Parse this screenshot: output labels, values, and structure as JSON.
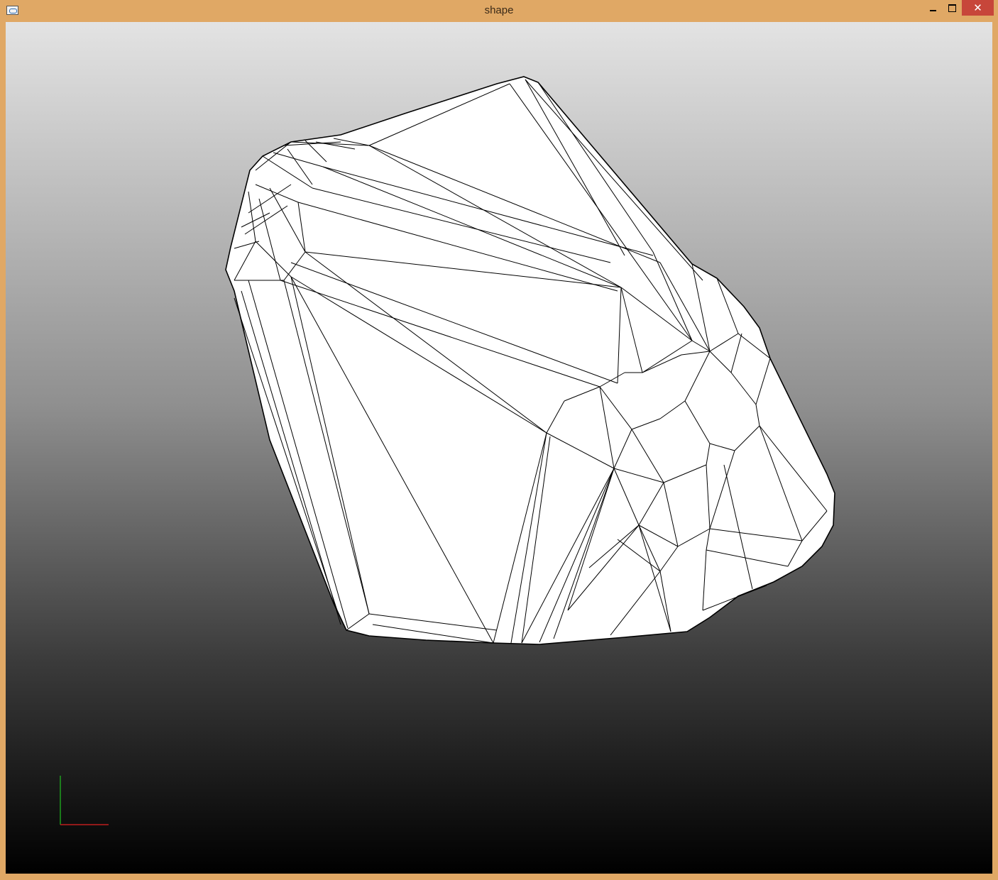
{
  "window": {
    "title": "shape",
    "icon": "app-icon",
    "controls": {
      "minimize": "minimize-icon",
      "maximize": "maximize-icon",
      "close": "close-icon",
      "close_glyph": "✕"
    },
    "frame_color": "#e0a865",
    "close_color": "#c7463a"
  },
  "viewport": {
    "background_top": "#e3e3e3",
    "background_bottom": "#000000",
    "model": "wireframe-triangulated-shape",
    "model_fill": "#ffffff",
    "model_stroke": "#000000",
    "axis_x_color": "#e02020",
    "axis_y_color": "#20c020"
  }
}
